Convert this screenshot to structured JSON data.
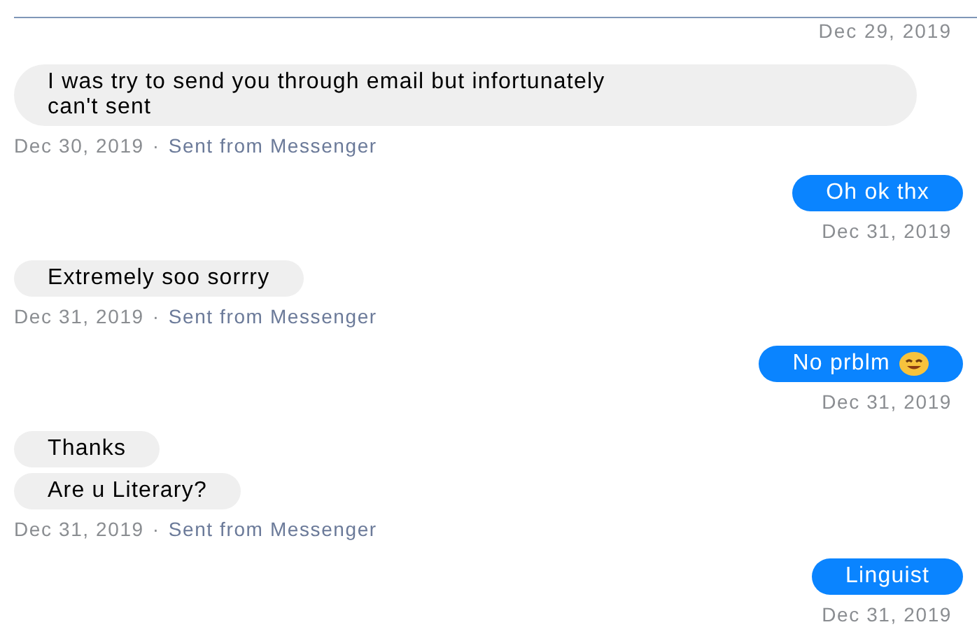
{
  "top_date": "Dec 29, 2019",
  "groups": [
    {
      "kind": "incoming",
      "bubbles": [
        {
          "text": "I was try to send you through email but infortunately can't sent"
        }
      ],
      "date": "Dec 30, 2019",
      "separator": "·",
      "source": "Sent from Messenger"
    },
    {
      "kind": "outgoing",
      "bubbles": [
        {
          "text": "Oh ok thx",
          "emoji": false
        }
      ],
      "date": "Dec 31, 2019"
    },
    {
      "kind": "incoming",
      "bubbles": [
        {
          "text": "Extremely soo sorrry"
        }
      ],
      "date": "Dec 31, 2019",
      "separator": "·",
      "source": "Sent from Messenger"
    },
    {
      "kind": "outgoing",
      "bubbles": [
        {
          "text": "No prblm",
          "emoji": true
        }
      ],
      "date": "Dec 31, 2019"
    },
    {
      "kind": "incoming",
      "bubbles": [
        {
          "text": "Thanks"
        },
        {
          "text": "Are u Literary?"
        }
      ],
      "date": "Dec 31, 2019",
      "separator": "·",
      "source": "Sent from Messenger"
    },
    {
      "kind": "outgoing",
      "bubbles": [
        {
          "text": "Linguist",
          "emoji": false
        }
      ],
      "date": "Dec 31, 2019"
    }
  ]
}
